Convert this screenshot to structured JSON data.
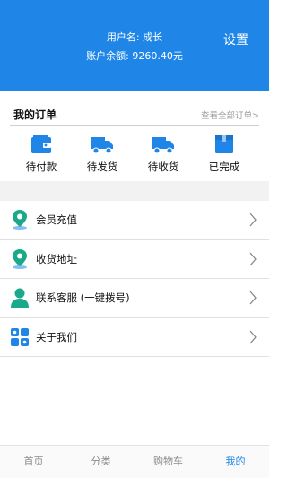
{
  "header": {
    "username": "用户名: 成长",
    "balance": "账户余额: 9260.40元",
    "settings": "设置"
  },
  "orders": {
    "title": "我的订单",
    "view_all": "查看全部订单>",
    "items": [
      {
        "label": "待付款",
        "icon": "wallet-icon"
      },
      {
        "label": "待发货",
        "icon": "truck-icon"
      },
      {
        "label": "待收货",
        "icon": "truck-icon"
      },
      {
        "label": "已完成",
        "icon": "box-icon"
      }
    ]
  },
  "menu": {
    "items": [
      {
        "label": "会员充值",
        "icon": "location-pin-icon"
      },
      {
        "label": "收货地址",
        "icon": "location-pin-icon"
      },
      {
        "label": "联系客服 (一键拨号)",
        "icon": "user-icon"
      },
      {
        "label": "关于我们",
        "icon": "grid-icon"
      }
    ]
  },
  "tabbar": {
    "items": [
      {
        "label": "首页",
        "active": false
      },
      {
        "label": "分类",
        "active": false
      },
      {
        "label": "购物车",
        "active": false
      },
      {
        "label": "我的",
        "active": true
      }
    ]
  },
  "colors": {
    "primary": "#1f86e8",
    "teal": "#1aa98a",
    "divider_bg": "#f2f2f2"
  }
}
